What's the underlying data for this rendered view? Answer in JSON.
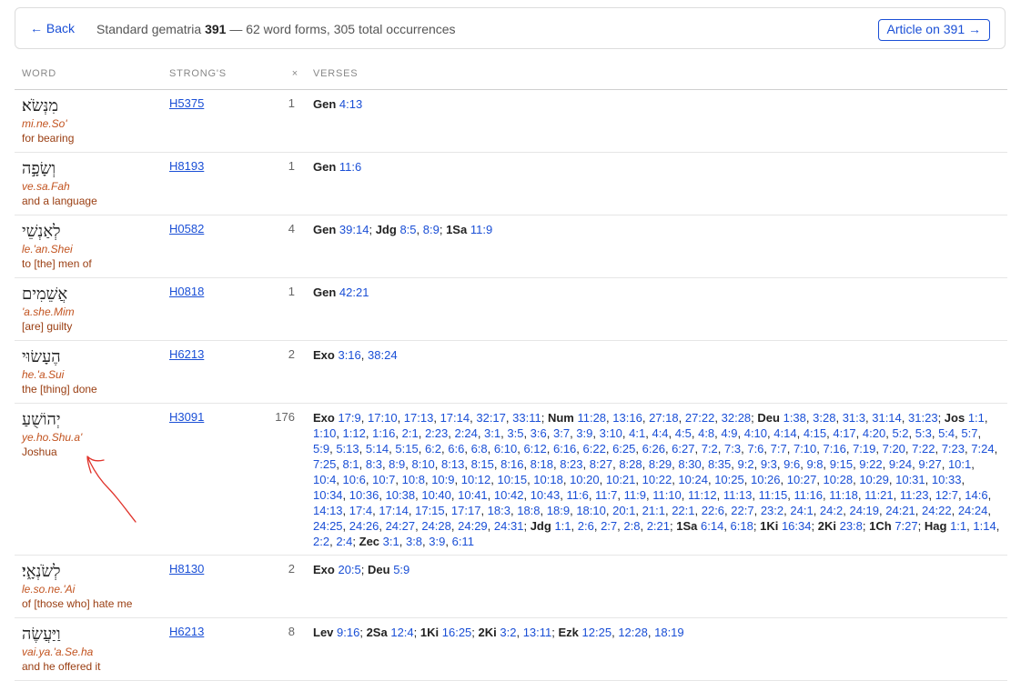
{
  "header": {
    "back_label": "← Back",
    "summary_prefix": "Standard gematria ",
    "gematria_value": "391",
    "summary_suffix": " — 62 word forms, 305 total occurrences",
    "article_label": "Article on 391 →"
  },
  "table": {
    "columns": {
      "word": "WORD",
      "strongs": "STRONG'S",
      "count": "×",
      "verses": "VERSES"
    },
    "rows": [
      {
        "hebrew": "מִנְּשֹׂא׃",
        "translit": "mi.ne.So'",
        "gloss": "for bearing",
        "strongs": "H5375",
        "count": "1",
        "verses": [
          {
            "book": "Gen",
            "refs": [
              "4:13"
            ]
          }
        ]
      },
      {
        "hebrew": "וְשָׂפָ֣ה",
        "translit": "ve.sa.Fah",
        "gloss": "and a language",
        "strongs": "H8193",
        "count": "1",
        "verses": [
          {
            "book": "Gen",
            "refs": [
              "11:6"
            ]
          }
        ]
      },
      {
        "hebrew": "לְאַנְשֵׁי",
        "translit": "le.'an.Shei",
        "gloss": "to [the] men of",
        "strongs": "H0582",
        "count": "4",
        "verses": [
          {
            "book": "Gen",
            "refs": [
              "39:14"
            ]
          },
          {
            "book": "Jdg",
            "refs": [
              "8:5",
              "8:9"
            ]
          },
          {
            "book": "1Sa",
            "refs": [
              "11:9"
            ]
          }
        ]
      },
      {
        "hebrew": "אֲשֵׁמִים",
        "translit": "'a.she.Mim",
        "gloss": "[are] guilty",
        "strongs": "H0818",
        "count": "1",
        "verses": [
          {
            "book": "Gen",
            "refs": [
              "42:21"
            ]
          }
        ]
      },
      {
        "hebrew": "הֶעָשׂוּי",
        "translit": "he.'a.Sui",
        "gloss": "the [thing] done",
        "strongs": "H6213",
        "count": "2",
        "verses": [
          {
            "book": "Exo",
            "refs": [
              "3:16",
              "38:24"
            ]
          }
        ]
      },
      {
        "hebrew": "יְהוֹשֻׁעַ",
        "translit": "ye.ho.Shu.a'",
        "gloss": "Joshua",
        "strongs": "H3091",
        "count": "176",
        "verses": [
          {
            "book": "Exo",
            "refs": [
              "17:9",
              "17:10",
              "17:13",
              "17:14",
              "32:17",
              "33:11"
            ]
          },
          {
            "book": "Num",
            "refs": [
              "11:28",
              "13:16",
              "27:18",
              "27:22",
              "32:28"
            ]
          },
          {
            "book": "Deu",
            "refs": [
              "1:38",
              "3:28",
              "31:3",
              "31:14",
              "31:23"
            ]
          },
          {
            "book": "Jos",
            "refs": [
              "1:1",
              "1:10",
              "1:12",
              "1:16",
              "2:1",
              "2:23",
              "2:24",
              "3:1",
              "3:5",
              "3:6",
              "3:7",
              "3:9",
              "3:10",
              "4:1",
              "4:4",
              "4:5",
              "4:8",
              "4:9",
              "4:10",
              "4:14",
              "4:15",
              "4:17",
              "4:20",
              "5:2",
              "5:3",
              "5:4",
              "5:7",
              "5:9",
              "5:13",
              "5:14",
              "5:15",
              "6:2",
              "6:6",
              "6:8",
              "6:10",
              "6:12",
              "6:16",
              "6:22",
              "6:25",
              "6:26",
              "6:27",
              "7:2",
              "7:3",
              "7:6",
              "7:7",
              "7:10",
              "7:16",
              "7:19",
              "7:20",
              "7:22",
              "7:23",
              "7:24",
              "7:25",
              "8:1",
              "8:3",
              "8:9",
              "8:10",
              "8:13",
              "8:15",
              "8:16",
              "8:18",
              "8:23",
              "8:27",
              "8:28",
              "8:29",
              "8:30",
              "8:35",
              "9:2",
              "9:3",
              "9:6",
              "9:8",
              "9:15",
              "9:22",
              "9:24",
              "9:27",
              "10:1",
              "10:4",
              "10:6",
              "10:7",
              "10:8",
              "10:9",
              "10:12",
              "10:15",
              "10:18",
              "10:20",
              "10:21",
              "10:22",
              "10:24",
              "10:25",
              "10:26",
              "10:27",
              "10:28",
              "10:29",
              "10:31",
              "10:33",
              "10:34",
              "10:36",
              "10:38",
              "10:40",
              "10:41",
              "10:42",
              "10:43",
              "11:6",
              "11:7",
              "11:9",
              "11:10",
              "11:12",
              "11:13",
              "11:15",
              "11:16",
              "11:18",
              "11:21",
              "11:23",
              "12:7",
              "14:6",
              "14:13",
              "17:4",
              "17:14",
              "17:15",
              "17:17",
              "18:3",
              "18:8",
              "18:9",
              "18:10",
              "20:1",
              "21:1",
              "22:1",
              "22:6",
              "22:7",
              "23:2",
              "24:1",
              "24:2",
              "24:19",
              "24:21",
              "24:22",
              "24:24",
              "24:25",
              "24:26",
              "24:27",
              "24:28",
              "24:29",
              "24:31"
            ]
          },
          {
            "book": "Jdg",
            "refs": [
              "1:1",
              "2:6",
              "2:7",
              "2:8",
              "2:21"
            ]
          },
          {
            "book": "1Sa",
            "refs": [
              "6:14",
              "6:18"
            ]
          },
          {
            "book": "1Ki",
            "refs": [
              "16:34"
            ]
          },
          {
            "book": "2Ki",
            "refs": [
              "23:8"
            ]
          },
          {
            "book": "1Ch",
            "refs": [
              "7:27"
            ]
          },
          {
            "book": "Hag",
            "refs": [
              "1:1",
              "1:14",
              "2:2",
              "2:4"
            ]
          },
          {
            "book": "Zec",
            "refs": [
              "3:1",
              "3:8",
              "3:9",
              "6:11"
            ]
          }
        ]
      },
      {
        "hebrew": "לְשֹׂנְאָ֑י׃",
        "translit": "le.so.ne.'Ai",
        "gloss": "of [those who] hate me",
        "strongs": "H8130",
        "count": "2",
        "verses": [
          {
            "book": "Exo",
            "refs": [
              "20:5"
            ]
          },
          {
            "book": "Deu",
            "refs": [
              "5:9"
            ]
          }
        ]
      },
      {
        "hebrew": "וַיַּעֲשֶׂה",
        "translit": "vai.ya.'a.Se.ha",
        "gloss": "and he offered it",
        "strongs": "H6213",
        "count": "8",
        "verses": [
          {
            "book": "Lev",
            "refs": [
              "9:16"
            ]
          },
          {
            "book": "2Sa",
            "refs": [
              "12:4"
            ]
          },
          {
            "book": "1Ki",
            "refs": [
              "16:25"
            ]
          },
          {
            "book": "2Ki",
            "refs": [
              "3:2",
              "13:11"
            ]
          },
          {
            "book": "Ezk",
            "refs": [
              "12:25",
              "12:28",
              "18:19"
            ]
          }
        ]
      }
    ]
  },
  "annotation": {
    "color": "#e0332b",
    "icon": "hand-drawn-arrow-icon"
  }
}
